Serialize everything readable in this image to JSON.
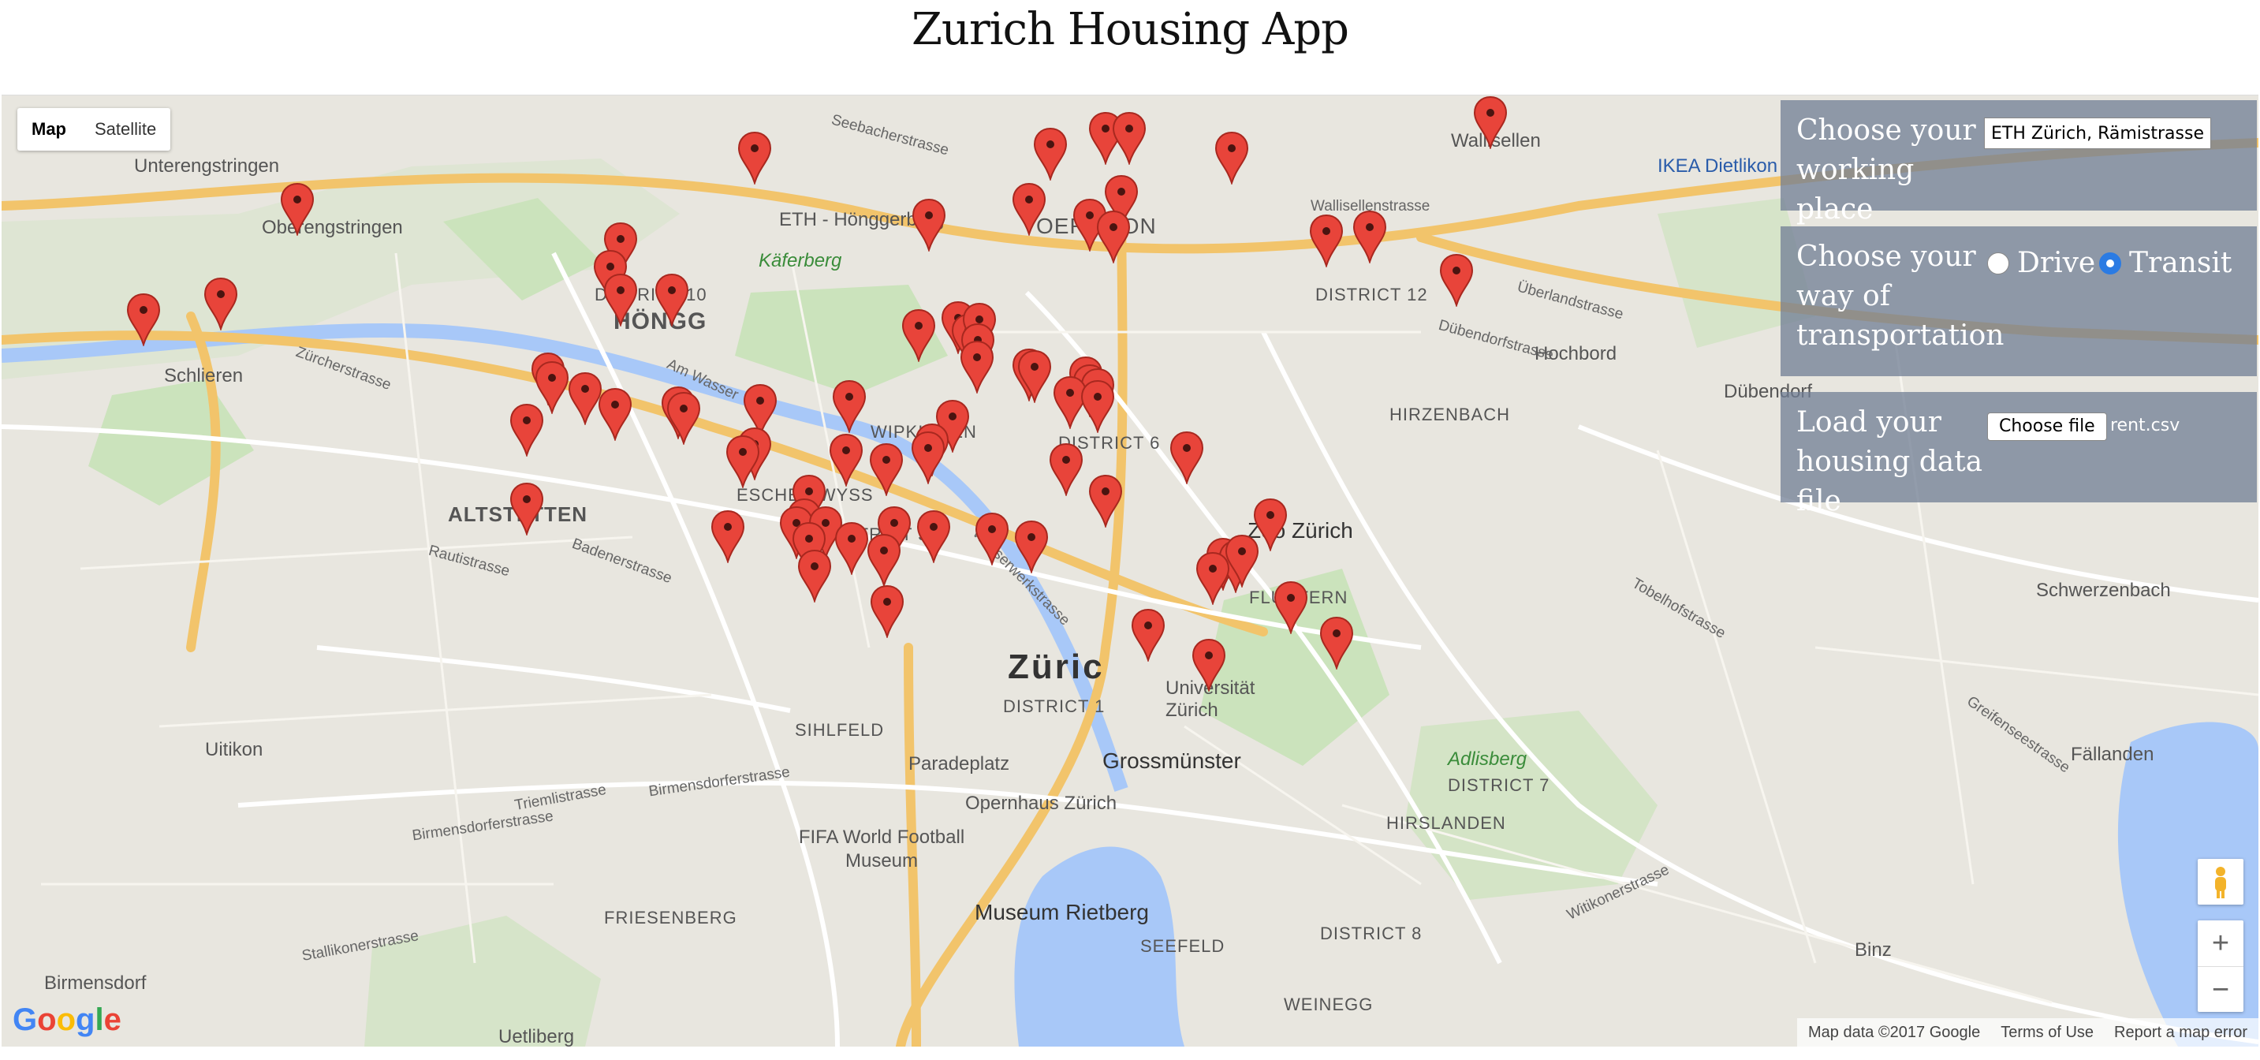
{
  "app_title": "Zurich Housing App",
  "map_type_toggle": {
    "map_label": "Map",
    "satellite_label": "Satellite",
    "active": "Map"
  },
  "controls": {
    "work": {
      "label": "Choose your working place",
      "value": "ETH Zürich, Rämistrasse, Züric"
    },
    "transport": {
      "label": "Choose your way of transportation",
      "options": [
        "Drive",
        "Transit"
      ],
      "selected": "Transit"
    },
    "file": {
      "label": "Load your housing data file",
      "button_label": "Choose file",
      "file_name": "rent.csv"
    }
  },
  "map_labels": {
    "places": [
      "Unterengstringen",
      "Oberengstringen",
      "Schlieren",
      "Wallisellen",
      "Hochbord",
      "Dübendorf",
      "Schwerzenbach",
      "Fällanden",
      "Uitikon",
      "Birmensdorf",
      "Binz",
      "Adlisberg",
      "Zoo Zürich",
      "Käferberg",
      "IKEA Dietlikon",
      "Universität Zürich",
      "Grossmünster",
      "Opernhaus Zürich",
      "FIFA World Football Museum",
      "Museum Rietberg",
      "ETH - Hönggerberg",
      "Paradeplatz",
      "Uetliberg"
    ],
    "areas": [
      "HÖNGG",
      "ALTSTETTEN",
      "OERLIKON",
      "WIPKINGEN",
      "ESCHER WYSS",
      "DISTRICT 5",
      "DISTRICT 6",
      "DISTRICT 1",
      "DISTRICT 12",
      "DISTRICT 7",
      "DISTRICT 8",
      "DISTRICT 10",
      "HIRZENBACH",
      "FLUNTERN",
      "HIRSLANDEN",
      "FRIESENBERG",
      "SEEFELD",
      "WEINEGG",
      "SIHLFELD"
    ],
    "city": "Züric"
  },
  "footer": {
    "map_data": "Map data ©2017 Google",
    "terms": "Terms of Use",
    "report": "Report a map error"
  },
  "google_logo": "Google",
  "zoom": {
    "in": "+",
    "out": "−"
  },
  "colors": {
    "pin": "#e8443a",
    "panel": "#707e94",
    "water": "#a8c8f8",
    "park": "#c8e2b8"
  }
}
